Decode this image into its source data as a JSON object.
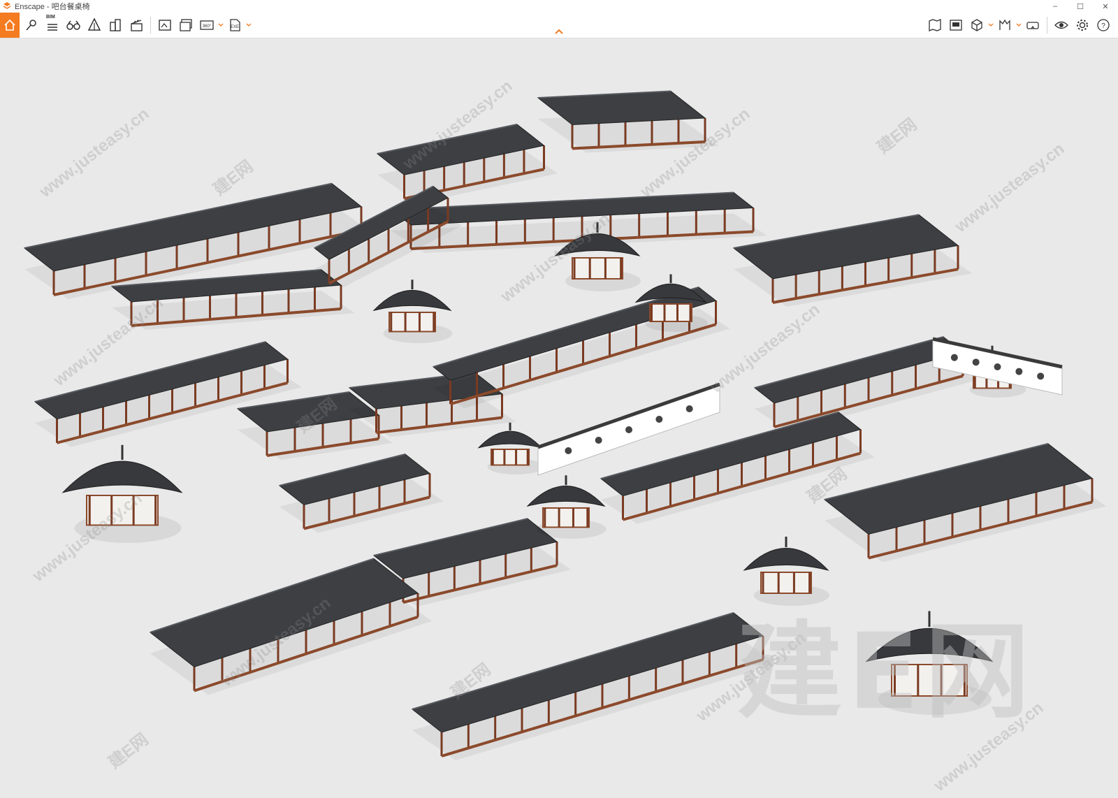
{
  "window": {
    "title": "Enscape - 吧台餐桌椅",
    "controls": {
      "minimize": "–",
      "maximize": "☐",
      "close": "✕"
    }
  },
  "toolbar": {
    "bim_label": "BIM",
    "btn_360": "360°",
    "btn_exe": "EXE",
    "accent": "#f47b20",
    "left_icons": [
      "home-icon",
      "pin-icon",
      "bim-icon",
      "binoculars-icon",
      "asset-library-icon",
      "buildings-icon",
      "clapperboard-icon",
      "render-image-icon",
      "batch-render-icon",
      "panorama-360-icon",
      "exe-export-icon"
    ],
    "right_icons": [
      "map-icon",
      "screenshot-gallery-icon",
      "cube-view-icon",
      "ruler-icon",
      "vr-headset-icon",
      "eye-icon",
      "settings-gear-icon",
      "help-icon"
    ]
  },
  "watermarks": {
    "site": "www.justeasy.cn",
    "brand": "建E网",
    "big": "建E网"
  },
  "scene": {
    "description_free": true
  }
}
